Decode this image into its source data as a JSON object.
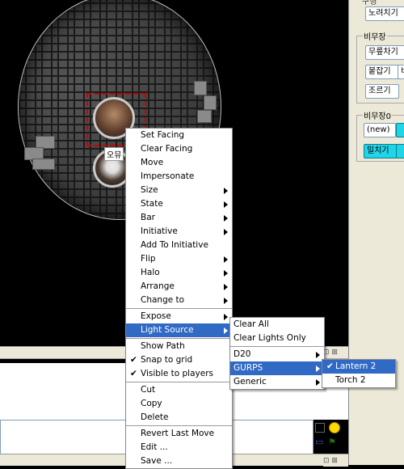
{
  "sidebar": {
    "top_button": "노려치기",
    "group1_label": "비무장",
    "group1_buttons": [
      "무릎차기",
      "붙잡기",
      "조르기"
    ],
    "group1_partial": "비",
    "group2_label": "비무장0",
    "group2_buttons": [
      "(new)",
      "밀치기"
    ]
  },
  "map": {
    "token_name": "오뮤"
  },
  "context_menu": {
    "items": [
      {
        "label": "Set Facing"
      },
      {
        "label": "Clear Facing"
      },
      {
        "label": "Move"
      },
      {
        "label": "Impersonate"
      },
      {
        "label": "Size",
        "submenu": true
      },
      {
        "label": "State",
        "submenu": true
      },
      {
        "label": "Bar",
        "submenu": true
      },
      {
        "label": "Initiative",
        "submenu": true
      },
      {
        "label": "Add To Initiative"
      },
      {
        "label": "Flip",
        "submenu": true
      },
      {
        "label": "Halo",
        "submenu": true
      },
      {
        "label": "Arrange",
        "submenu": true
      },
      {
        "label": "Change to",
        "submenu": true
      },
      {
        "label": "Expose",
        "submenu": true
      },
      {
        "label": "Light Source",
        "submenu": true,
        "highlighted": true
      },
      {
        "label": "Show Path"
      },
      {
        "label": "Snap to grid",
        "checked": true
      },
      {
        "label": "Visible to players",
        "checked": true
      },
      {
        "label": "Cut"
      },
      {
        "label": "Copy"
      },
      {
        "label": "Delete"
      },
      {
        "label": "Revert Last Move"
      },
      {
        "label": "Edit ..."
      },
      {
        "label": "Save ..."
      }
    ]
  },
  "light_source_menu": {
    "items": [
      {
        "label": "Clear All"
      },
      {
        "label": "Clear Lights Only"
      },
      {
        "label": "D20",
        "submenu": true
      },
      {
        "label": "GURPS",
        "submenu": true,
        "highlighted": true
      },
      {
        "label": "Generic",
        "submenu": true
      }
    ]
  },
  "gurps_menu": {
    "items": [
      {
        "label": "Lantern 2",
        "checked": true,
        "highlighted": true
      },
      {
        "label": "Torch 2"
      }
    ]
  },
  "panel": {
    "controls": "⊡ ⊠",
    "check_mark": "✔",
    "top_clip": "구형"
  },
  "icons": [
    "square-color-icon",
    "smiley-icon",
    "chat-bubble-icon",
    "flag-icon"
  ],
  "colors": {
    "menu_highlight": "#316ac5",
    "sidebar_bg": "#ece9d8",
    "selection_dash": "#cc0000",
    "cyan_button": "#21d5e9"
  }
}
